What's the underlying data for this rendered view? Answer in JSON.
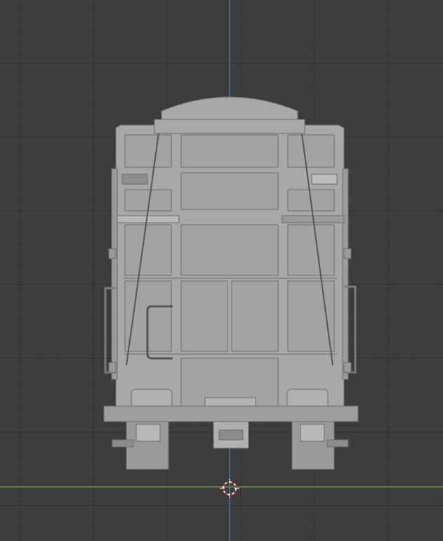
{
  "viewport": {
    "view": "front-orthographic",
    "object": "boxcar-model",
    "colors": {
      "background": "#3d3d3d",
      "grid_minor": "#353535",
      "grid_major": "#2b2b2b",
      "axis_z": "#4f7fb8",
      "axis_y": "#6fa24a",
      "model_fill": "#a8a8a8",
      "model_dark": "#8a8a8a",
      "model_line": "#6c6c6c",
      "cursor_red": "#d03030",
      "cursor_white": "#ffffff"
    },
    "icons": [
      "3d-cursor-icon"
    ]
  }
}
